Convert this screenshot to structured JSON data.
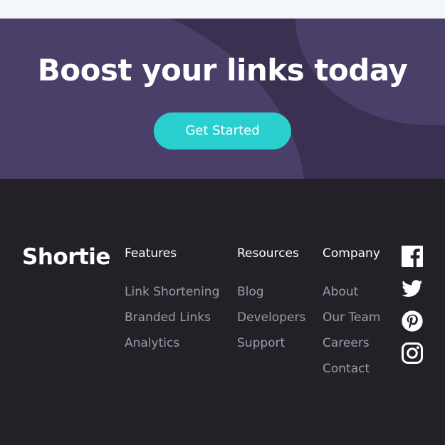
{
  "boost": {
    "title": "Boost your links today",
    "cta_label": "Get Started"
  },
  "footer": {
    "logo": "Shortie",
    "columns": [
      {
        "title": "Features",
        "links": [
          "Link Shortening",
          "Branded Links",
          "Analytics"
        ]
      },
      {
        "title": "Resources",
        "links": [
          "Blog",
          "Developers",
          "Support"
        ]
      },
      {
        "title": "Company",
        "links": [
          "About",
          "Our Team",
          "Careers",
          "Contact"
        ]
      }
    ],
    "social_icons": [
      "facebook-icon",
      "twitter-icon",
      "pinterest-icon",
      "instagram-icon"
    ]
  },
  "colors": {
    "top_strip": "#f3f6fb",
    "boost_bg": "#3a3052",
    "boost_blob": "#4a3f68",
    "cta": "#2acfcf",
    "footer_bg": "#232027",
    "link_text": "#9e9aa7",
    "white": "#ffffff"
  }
}
